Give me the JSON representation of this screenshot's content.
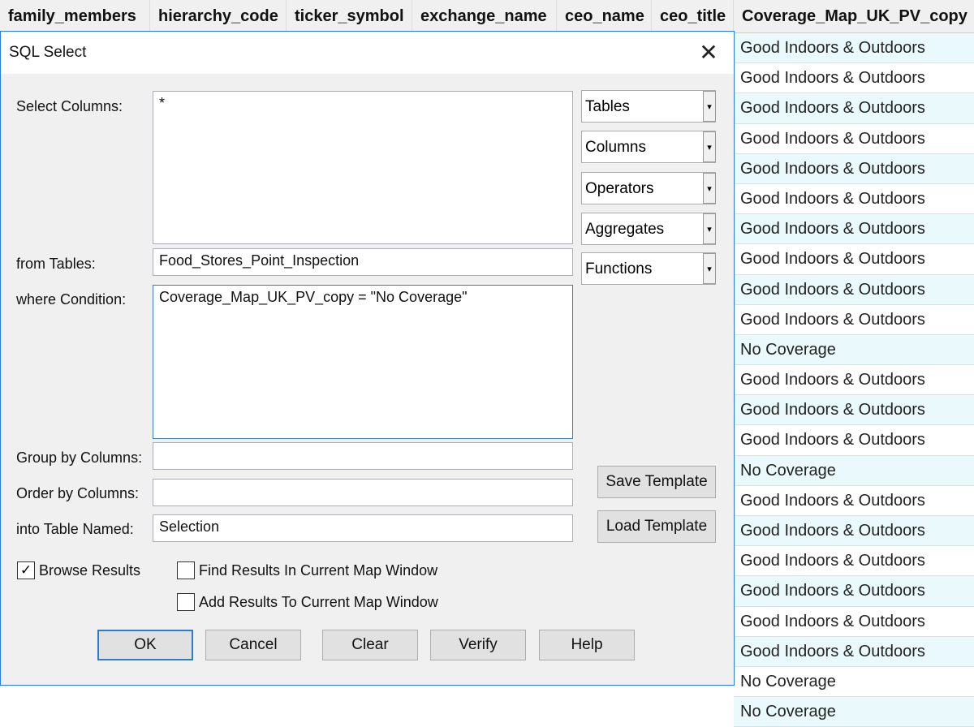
{
  "table": {
    "columns": [
      "family_members",
      "hierarchy_code",
      "ticker_symbol",
      "exchange_name",
      "ceo_name",
      "ceo_title",
      "Coverage_Map_UK_PV_copy"
    ],
    "coverage_values": [
      "Good Indoors & Outdoors",
      "Good Indoors & Outdoors",
      "Good Indoors & Outdoors",
      "Good Indoors & Outdoors",
      "Good Indoors & Outdoors",
      "Good Indoors & Outdoors",
      "Good Indoors & Outdoors",
      "Good Indoors & Outdoors",
      "Good Indoors & Outdoors",
      "Good Indoors & Outdoors",
      "No Coverage",
      "Good Indoors & Outdoors",
      "Good Indoors & Outdoors",
      "Good Indoors & Outdoors",
      "No Coverage",
      "Good Indoors & Outdoors",
      "Good Indoors & Outdoors",
      "Good Indoors & Outdoors",
      "Good Indoors & Outdoors",
      "Good Indoors & Outdoors",
      "Good Indoors & Outdoors",
      "No Coverage",
      "No Coverage"
    ]
  },
  "dialog": {
    "title": "SQL Select",
    "labels": {
      "select_columns": "Select Columns:",
      "from_tables": "from Tables:",
      "where": "where Condition:",
      "group_by": "Group by Columns:",
      "order_by": "Order by Columns:",
      "into_table": "into Table Named:"
    },
    "values": {
      "select_columns": "*",
      "from_tables": "Food_Stores_Point_Inspection",
      "where": "Coverage_Map_UK_PV_copy = \"No Coverage\"",
      "group_by": "",
      "order_by": "",
      "into_table": "Selection"
    },
    "dropdowns": [
      "Tables",
      "Columns",
      "Operators",
      "Aggregates",
      "Functions"
    ],
    "save_template": "Save Template",
    "load_template": "Load Template",
    "checkboxes": {
      "browse": {
        "label": "Browse Results",
        "checked": true
      },
      "find": {
        "label": "Find Results In Current Map Window",
        "checked": false
      },
      "add": {
        "label": "Add Results To Current Map Window",
        "checked": false
      }
    },
    "buttons": {
      "ok": "OK",
      "cancel": "Cancel",
      "clear": "Clear",
      "verify": "Verify",
      "help": "Help"
    }
  }
}
